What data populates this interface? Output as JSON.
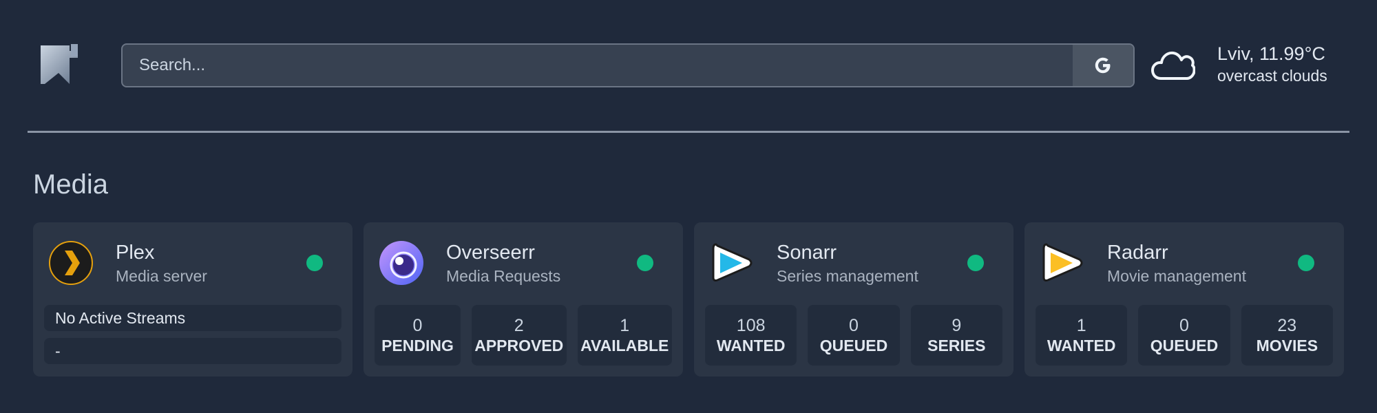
{
  "header": {
    "logo_icon": "bookmark-logo-icon",
    "search": {
      "placeholder": "Search...",
      "value": "",
      "provider_label": "G"
    },
    "weather": {
      "icon": "cloud-icon",
      "location_temp": "Lviv, 11.99°C",
      "description": "overcast clouds"
    }
  },
  "section": {
    "title": "Media"
  },
  "cards": [
    {
      "name": "Plex",
      "description": "Media server",
      "icon": "plex-icon",
      "status_color": "#10b981",
      "streams": [
        "No Active Streams",
        "-"
      ]
    },
    {
      "name": "Overseerr",
      "description": "Media Requests",
      "icon": "overseerr-icon",
      "status_color": "#10b981",
      "stats": [
        {
          "value": "0",
          "label": "PENDING"
        },
        {
          "value": "2",
          "label": "APPROVED"
        },
        {
          "value": "1",
          "label": "AVAILABLE"
        }
      ]
    },
    {
      "name": "Sonarr",
      "description": "Series management",
      "icon": "sonarr-icon",
      "status_color": "#10b981",
      "stats": [
        {
          "value": "108",
          "label": "WANTED"
        },
        {
          "value": "0",
          "label": "QUEUED"
        },
        {
          "value": "9",
          "label": "SERIES"
        }
      ]
    },
    {
      "name": "Radarr",
      "description": "Movie management",
      "icon": "radarr-icon",
      "status_color": "#10b981",
      "stats": [
        {
          "value": "1",
          "label": "WANTED"
        },
        {
          "value": "0",
          "label": "QUEUED"
        },
        {
          "value": "23",
          "label": "MOVIES"
        }
      ]
    }
  ]
}
